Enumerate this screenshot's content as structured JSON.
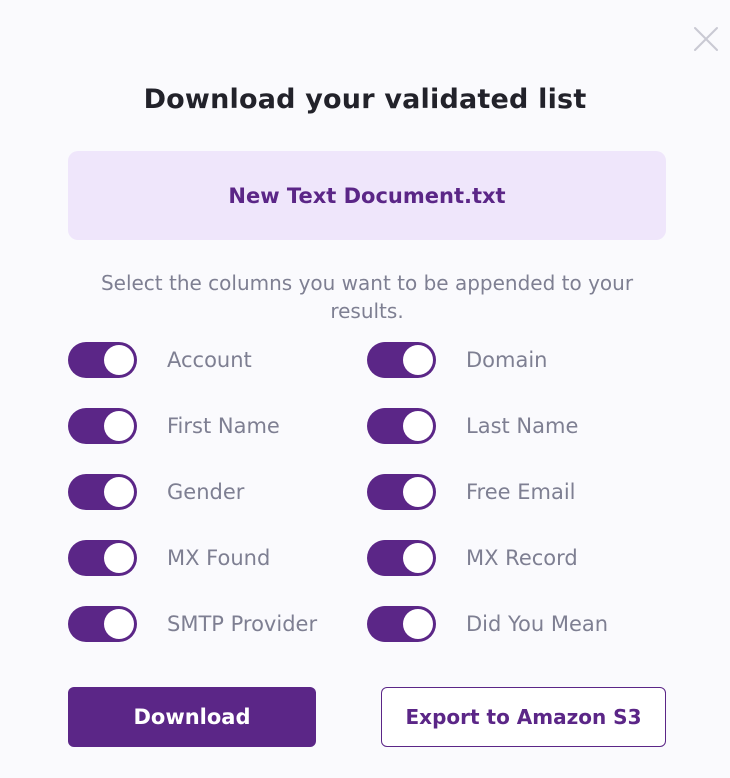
{
  "modal": {
    "title": "Download your validated list",
    "file_name": "New Text Document.txt",
    "instructions": "Select the columns you want to be appended to your results.",
    "colors": {
      "accent": "#5b2687",
      "file_box_bg": "#efe6fb",
      "label_text": "#7e7f92",
      "title_text": "#22222a"
    },
    "toggles": {
      "account": {
        "label": "Account",
        "on": true
      },
      "domain": {
        "label": "Domain",
        "on": true
      },
      "first_name": {
        "label": "First Name",
        "on": true
      },
      "last_name": {
        "label": "Last Name",
        "on": true
      },
      "gender": {
        "label": "Gender",
        "on": true
      },
      "free_email": {
        "label": "Free Email",
        "on": true
      },
      "mx_found": {
        "label": "MX Found",
        "on": true
      },
      "mx_record": {
        "label": "MX Record",
        "on": true
      },
      "smtp_provider": {
        "label": "SMTP Provider",
        "on": true
      },
      "did_you_mean": {
        "label": "Did You Mean",
        "on": true
      }
    },
    "buttons": {
      "download_label": "Download",
      "export_label": "Export to Amazon S3"
    },
    "icons": {
      "close": "close-icon"
    }
  }
}
